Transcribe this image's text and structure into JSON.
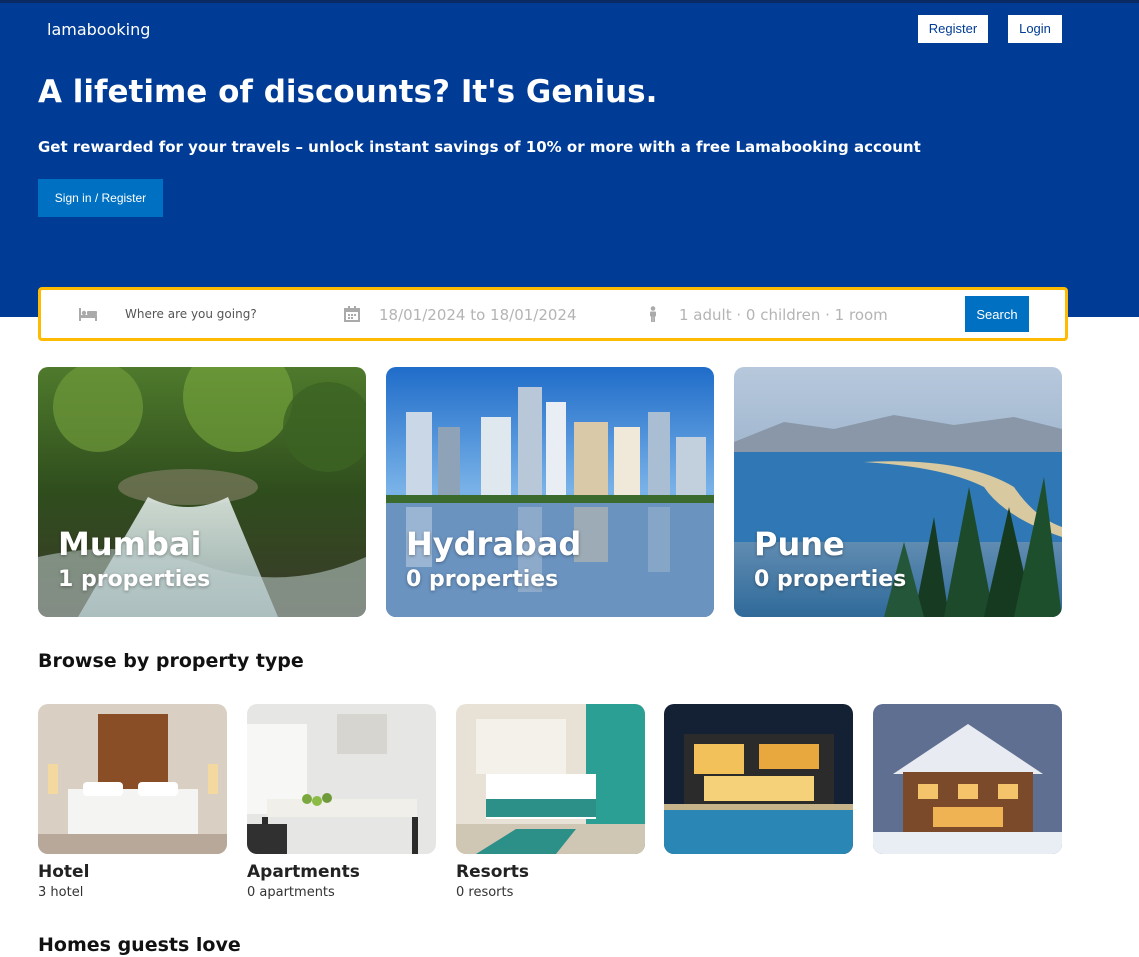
{
  "nav": {
    "logo": "lamabooking",
    "register_label": "Register",
    "login_label": "Login"
  },
  "hero": {
    "title": "A lifetime of discounts? It's Genius.",
    "description": "Get rewarded for your travels – unlock instant savings of 10% or more with a free Lamabooking account",
    "cta_label": "Sign in / Register"
  },
  "search": {
    "destination_placeholder": "Where are you going?",
    "dates": "18/01/2024 to 18/01/2024",
    "guests": "1 adult · 0 children · 1 room",
    "button_label": "Search",
    "icons": [
      "bed-icon",
      "calendar-icon",
      "person-icon"
    ]
  },
  "featured": [
    {
      "name": "Mumbai",
      "count": "1 properties"
    },
    {
      "name": "Hydrabad",
      "count": "0 properties"
    },
    {
      "name": "Pune",
      "count": "0 properties"
    }
  ],
  "property_section": {
    "title": "Browse by property type",
    "items": [
      {
        "name": "Hotel",
        "count": "3 hotel"
      },
      {
        "name": "Apartments",
        "count": "0 apartments"
      },
      {
        "name": "Resorts",
        "count": "0 resorts"
      },
      {
        "name": "",
        "count": ""
      },
      {
        "name": "",
        "count": ""
      }
    ]
  },
  "homes_section": {
    "title": "Homes guests love"
  },
  "colors": {
    "brand_blue": "#003b95",
    "button_blue": "#0071c2",
    "search_border": "#febb02"
  }
}
